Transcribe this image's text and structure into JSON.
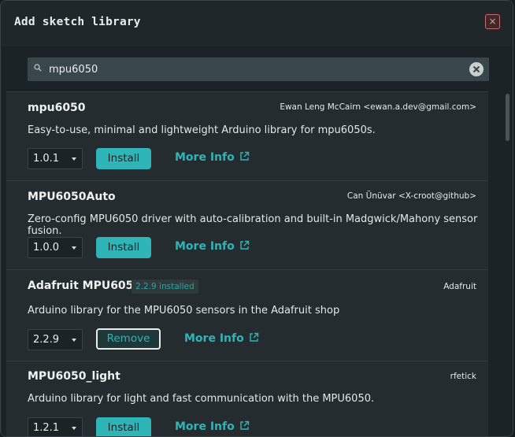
{
  "dialog": {
    "title": "Add sketch library",
    "close_glyph": "×"
  },
  "search": {
    "value": "mpu6050",
    "icon": "search-icon",
    "clear_icon": "clear-circle-icon"
  },
  "libraries": [
    {
      "name": "mpu6050",
      "author": "Ewan Leng McCairn <ewan.a.dev@gmail.com>",
      "description": "Easy-to-use, minimal and lightweight Arduino library for mpu6050s.",
      "version": "1.0.1",
      "action_label": "Install",
      "more_info": "More Info",
      "installed_badge": ""
    },
    {
      "name": "MPU6050Auto",
      "author": "Can Ünüvar <X-croot@github>",
      "description": "Zero-config MPU6050 driver with auto-calibration and built-in Madgwick/Mahony sensor fusion.",
      "version": "1.0.0",
      "action_label": "Install",
      "more_info": "More Info",
      "installed_badge": ""
    },
    {
      "name": "Adafruit MPU6050",
      "author": "Adafruit",
      "description": "Arduino library for the MPU6050 sensors in the Adafruit shop",
      "version": "2.2.9",
      "action_label": "Remove",
      "more_info": "More Info",
      "installed_badge": "2.2.9 installed"
    },
    {
      "name": "MPU6050_light",
      "author": "rfetick",
      "description": "Arduino library for light and fast communication with the MPU6050.",
      "version": "1.2.1",
      "action_label": "Install",
      "more_info": "More Info",
      "installed_badge": ""
    }
  ],
  "colors": {
    "accent": "#2fb4b7",
    "background": "#1b2326",
    "card": "#242c2f",
    "close": "#d06a6a"
  }
}
